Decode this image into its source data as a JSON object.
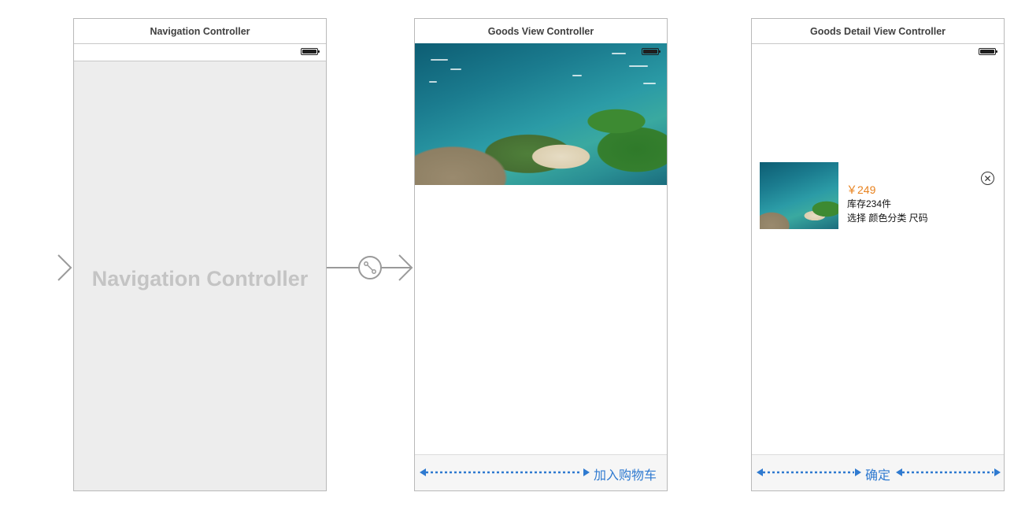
{
  "scenes": {
    "navigation": {
      "title": "Navigation Controller",
      "placeholder": "Navigation Controller"
    },
    "goods": {
      "title": "Goods View Controller",
      "add_to_cart_label": "加入购物车"
    },
    "goods_detail": {
      "title": "Goods Detail View Controller",
      "price": "￥249",
      "stock": "库存234件",
      "options": "选择 颜色分类 尺码",
      "confirm_label": "确定"
    }
  },
  "icons": {
    "entry_arrow": "arrow-right-icon",
    "segue": "segue-link-icon",
    "battery": "battery-icon",
    "close": "close-circle-icon"
  },
  "colors": {
    "constraint_blue": "#2f7ad0",
    "price_orange": "#e8821e",
    "canvas_gray": "#ededed"
  }
}
